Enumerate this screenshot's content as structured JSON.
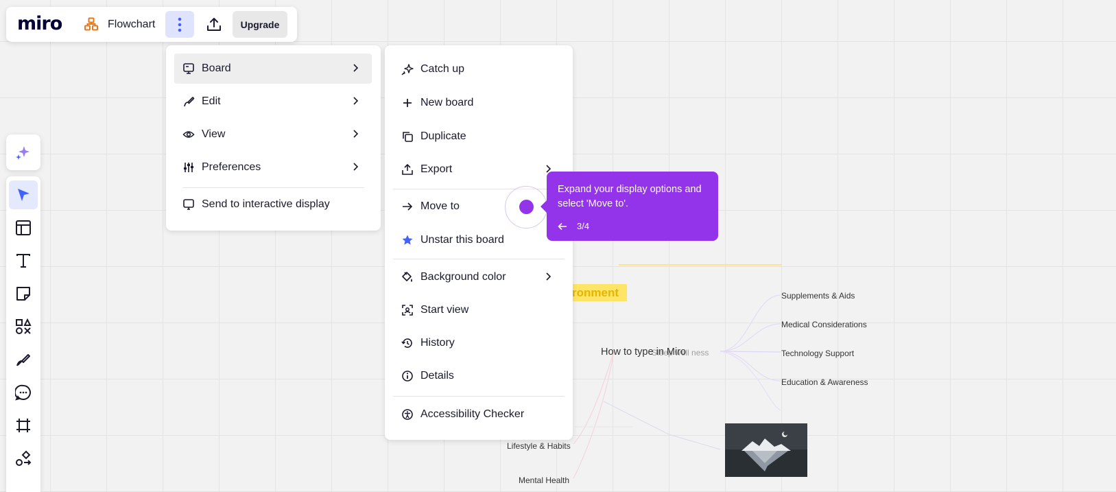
{
  "topbar": {
    "logo": "miro",
    "board_title": "Flowchart",
    "upgrade_label": "Upgrade"
  },
  "main_menu": {
    "items": [
      {
        "label": "Board",
        "icon": "board-icon",
        "has_submenu": true,
        "highlighted": true
      },
      {
        "label": "Edit",
        "icon": "pen-icon",
        "has_submenu": true
      },
      {
        "label": "View",
        "icon": "eye-icon",
        "has_submenu": true
      },
      {
        "label": "Preferences",
        "icon": "sliders-icon",
        "has_submenu": true
      }
    ],
    "footer_item": {
      "label": "Send to interactive display",
      "icon": "display-icon"
    }
  },
  "board_submenu": {
    "items": [
      {
        "label": "Catch up",
        "icon": "sparkles-icon"
      },
      {
        "label": "New board",
        "icon": "plus-icon"
      },
      {
        "label": "Duplicate",
        "icon": "duplicate-icon"
      },
      {
        "label": "Export",
        "icon": "export-icon",
        "has_submenu": true
      },
      {
        "label": "Move to",
        "icon": "arrow-right-icon"
      },
      {
        "label": "Unstar this board",
        "icon": "star-icon"
      },
      {
        "label": "Background color",
        "icon": "paint-bucket-icon",
        "has_submenu": true
      },
      {
        "label": "Start view",
        "icon": "start-view-icon"
      },
      {
        "label": "History",
        "icon": "history-icon"
      },
      {
        "label": "Details",
        "icon": "info-icon"
      },
      {
        "label": "Accessibility Checker",
        "icon": "accessibility-icon"
      }
    ]
  },
  "tooltip": {
    "text": "Expand your display options and select 'Move to'.",
    "step": "3/4",
    "color": "#9333ea"
  },
  "canvas": {
    "env_label": "ronment",
    "center_topic": "How to type in Miro",
    "center_topic_overlap": "Sleep well ness",
    "branches_right": [
      "Supplements & Aids",
      "Medical Considerations",
      "Technology Support",
      "Education & Awareness"
    ],
    "branches_left": [
      "Lifestyle & Habits",
      "Mental Health"
    ]
  },
  "toolbar": {
    "tools": [
      "ai-sparkle-icon",
      "select-icon",
      "templates-icon",
      "text-icon",
      "sticky-note-icon",
      "shapes-icon",
      "pen-icon",
      "comment-icon",
      "frame-icon",
      "more-tools-icon"
    ]
  },
  "colors": {
    "accent_blue": "#4262ff",
    "tooltip_purple": "#9333ea",
    "canvas_bg": "#f2f2f2"
  }
}
